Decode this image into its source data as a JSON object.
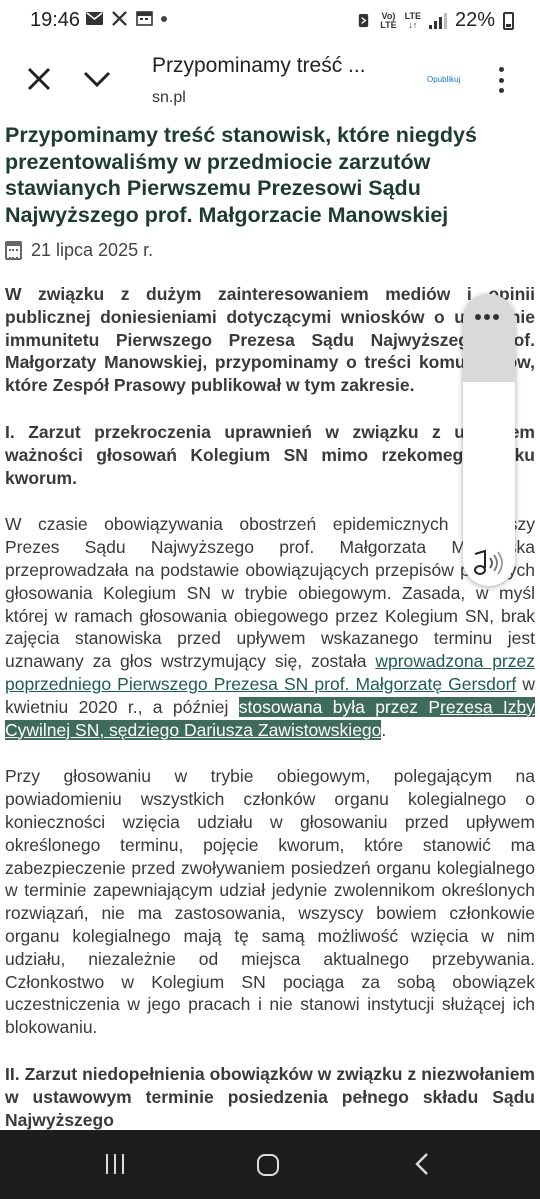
{
  "status_bar": {
    "time": "19:46",
    "lte_label_top": "Vo)",
    "lte_label_bottom": "LTE",
    "network": "LTE",
    "battery": "22%"
  },
  "browser": {
    "page_title": "Przypominamy treść ...",
    "domain": "sn.pl",
    "publish_label": "Opublikuj"
  },
  "article": {
    "title": "Przypominamy treść stanowisk, które niegdyś prezentowaliśmy w przedmiocie zarzutów stawianych Pierwszemu Prezesowi Sądu Najwyższego prof. Małgorzacie Manowskiej",
    "date": "21 lipca 2025 r.",
    "lead": "W związku z dużym zainteresowaniem mediów i opinii publicznej doniesieniami dotyczącymi wniosków o uchylenie immunitetu Pierwszego Prezesa Sądu Najwyższego prof. Małgorzaty Manowskiej, przypominamy o treści komunikatów, które Zespół Prasowy publikował w tym zakresie.",
    "section1_heading": "I. Zarzut przekroczenia uprawnień w związku z uznaniem ważności głosowań Kolegium SN mimo rzekomego braku kworum.",
    "para1_start": "W czasie obowiązywania obostrzeń epidemicznych Pierwszy Prezes Sądu Najwyższego prof. Małgorzata Manowska przeprowadzała na podstawie obowiązujących przepisów prawnych głosowania Kolegium SN w trybie obiegowym. Zasada, w myśl której w ramach głosowania obiegowego przez Kolegium SN, brak zajęcia stanowiska przed upływem wskazanego terminu jest uznawany za głos wstrzymujący się, została ",
    "para1_link1": "wprowadzona przez poprzedniego Pierwszego Prezesa SN prof. Małgorzatę Gersdorf",
    "para1_mid1": " w kwietniu 2020 r., a później ",
    "para1_mid2": "stosowana była przez P",
    "para1_link2": "rezesa Izby Cywilnej SN, sędziego Dariusza Zawistowskiego",
    "para1_end": ".",
    "para2": "Przy głosowaniu w trybie obiegowym, polegającym na powiadomieniu wszystkich członków organu kolegialnego o konieczności wzięcia udziału w głosowaniu przed upływem określonego terminu, pojęcie kworum, które stanowić ma zabezpieczenie przed zwoływaniem posiedzeń organu kolegialnego w terminie zapewniającym udział jedynie zwolennikom określonych rozwiązań, nie ma zastosowania, wszyscy bowiem członkowie organu kolegialnego mają tę samą możliwość wzięcia w nim udziału, niezależnie od miejsca aktualnego przebywania. Członkostwo w Kolegium SN pociąga za sobą obowiązek uczestniczenia w jego pracach i nie stanowi instytucji służącej ich blokowaniu.",
    "section2_heading": "II. Zarzut niedopełnienia obowiązków w związku z niezwołaniem w ustawowym terminie posiedzenia pełnego składu Sądu Najwyższego"
  },
  "floating_panel": {
    "top_icon": "more-horizontal-icon",
    "bottom_icon": "music-note-icon"
  },
  "nav_bar": {
    "icons": [
      "recent-apps-icon",
      "home-icon",
      "back-icon"
    ]
  }
}
